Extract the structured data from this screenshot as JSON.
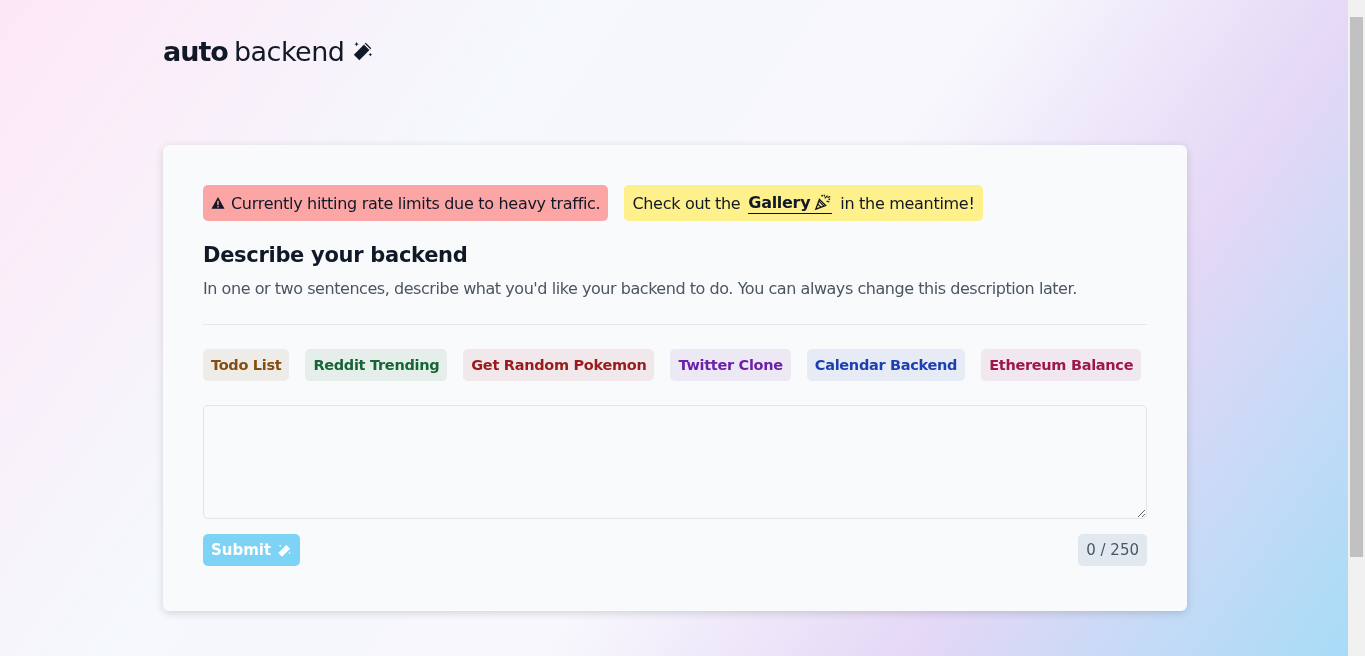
{
  "logo": {
    "bold": "auto",
    "light": "backend"
  },
  "notices": [
    {
      "kind": "warning",
      "text": "Currently hitting rate limits due to heavy traffic."
    },
    {
      "kind": "info",
      "before": "Check out the",
      "link": "Gallery",
      "after": "in the meantime!"
    }
  ],
  "heading": "Describe your backend",
  "description": "In one or two sentences, describe what you'd like your backend to do. You can always change this description later.",
  "examples": [
    {
      "label": "Todo List",
      "color": "#854d0e"
    },
    {
      "label": "Reddit Trending",
      "color": "#166534"
    },
    {
      "label": "Get Random Pokemon",
      "color": "#991b1b"
    },
    {
      "label": "Twitter Clone",
      "color": "#6b21a8"
    },
    {
      "label": "Calendar Backend",
      "color": "#1e40af"
    },
    {
      "label": "Ethereum Balance",
      "color": "#9d174d"
    }
  ],
  "submit": {
    "label": "Submit",
    "disabled": true
  },
  "counter": "0 / 250"
}
